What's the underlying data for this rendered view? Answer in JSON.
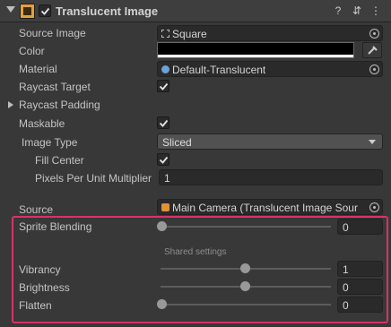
{
  "header": {
    "title": "Translucent Image",
    "enabled": true,
    "help_label": "?",
    "presets_label": "⇵",
    "menu_label": "⋮"
  },
  "fields": {
    "source_image": {
      "label": "Source Image",
      "value": "Square"
    },
    "color": {
      "label": "Color",
      "value_color": "#000000"
    },
    "material": {
      "label": "Material",
      "value": "Default-Translucent"
    },
    "raycast_target": {
      "label": "Raycast Target",
      "checked": true
    },
    "raycast_padding": {
      "label": "Raycast Padding"
    },
    "maskable": {
      "label": "Maskable",
      "checked": true
    },
    "image_type": {
      "label": "Image Type",
      "value": "Sliced"
    },
    "fill_center": {
      "label": "Fill Center",
      "checked": true
    },
    "pixels_per_unit": {
      "label": "Pixels Per Unit Multiplier",
      "value": "1"
    },
    "source": {
      "label": "Source",
      "value": "Main Camera (Translucent Image Sour"
    }
  },
  "blend": {
    "sprite_blending": {
      "label": "Sprite Blending",
      "value": "0",
      "fraction": 0.0
    },
    "shared_settings_label": "Shared settings",
    "vibrancy": {
      "label": "Vibrancy",
      "value": "1",
      "fraction": 0.5
    },
    "brightness": {
      "label": "Brightness",
      "value": "0",
      "fraction": 0.5
    },
    "flatten": {
      "label": "Flatten",
      "value": "0",
      "fraction": 0.0
    }
  },
  "colors": {
    "highlight": "#d6336c",
    "component_icon": "#e2a23a",
    "source_icon": "#e0913a"
  },
  "icons": [
    "chevron-down-icon",
    "translucent-image-component-icon",
    "checkbox-icon",
    "help-icon",
    "presets-icon",
    "menu-icon",
    "sprite-icon",
    "material-icon",
    "object-picker-icon",
    "eyedropper-icon",
    "camera-component-icon"
  ]
}
